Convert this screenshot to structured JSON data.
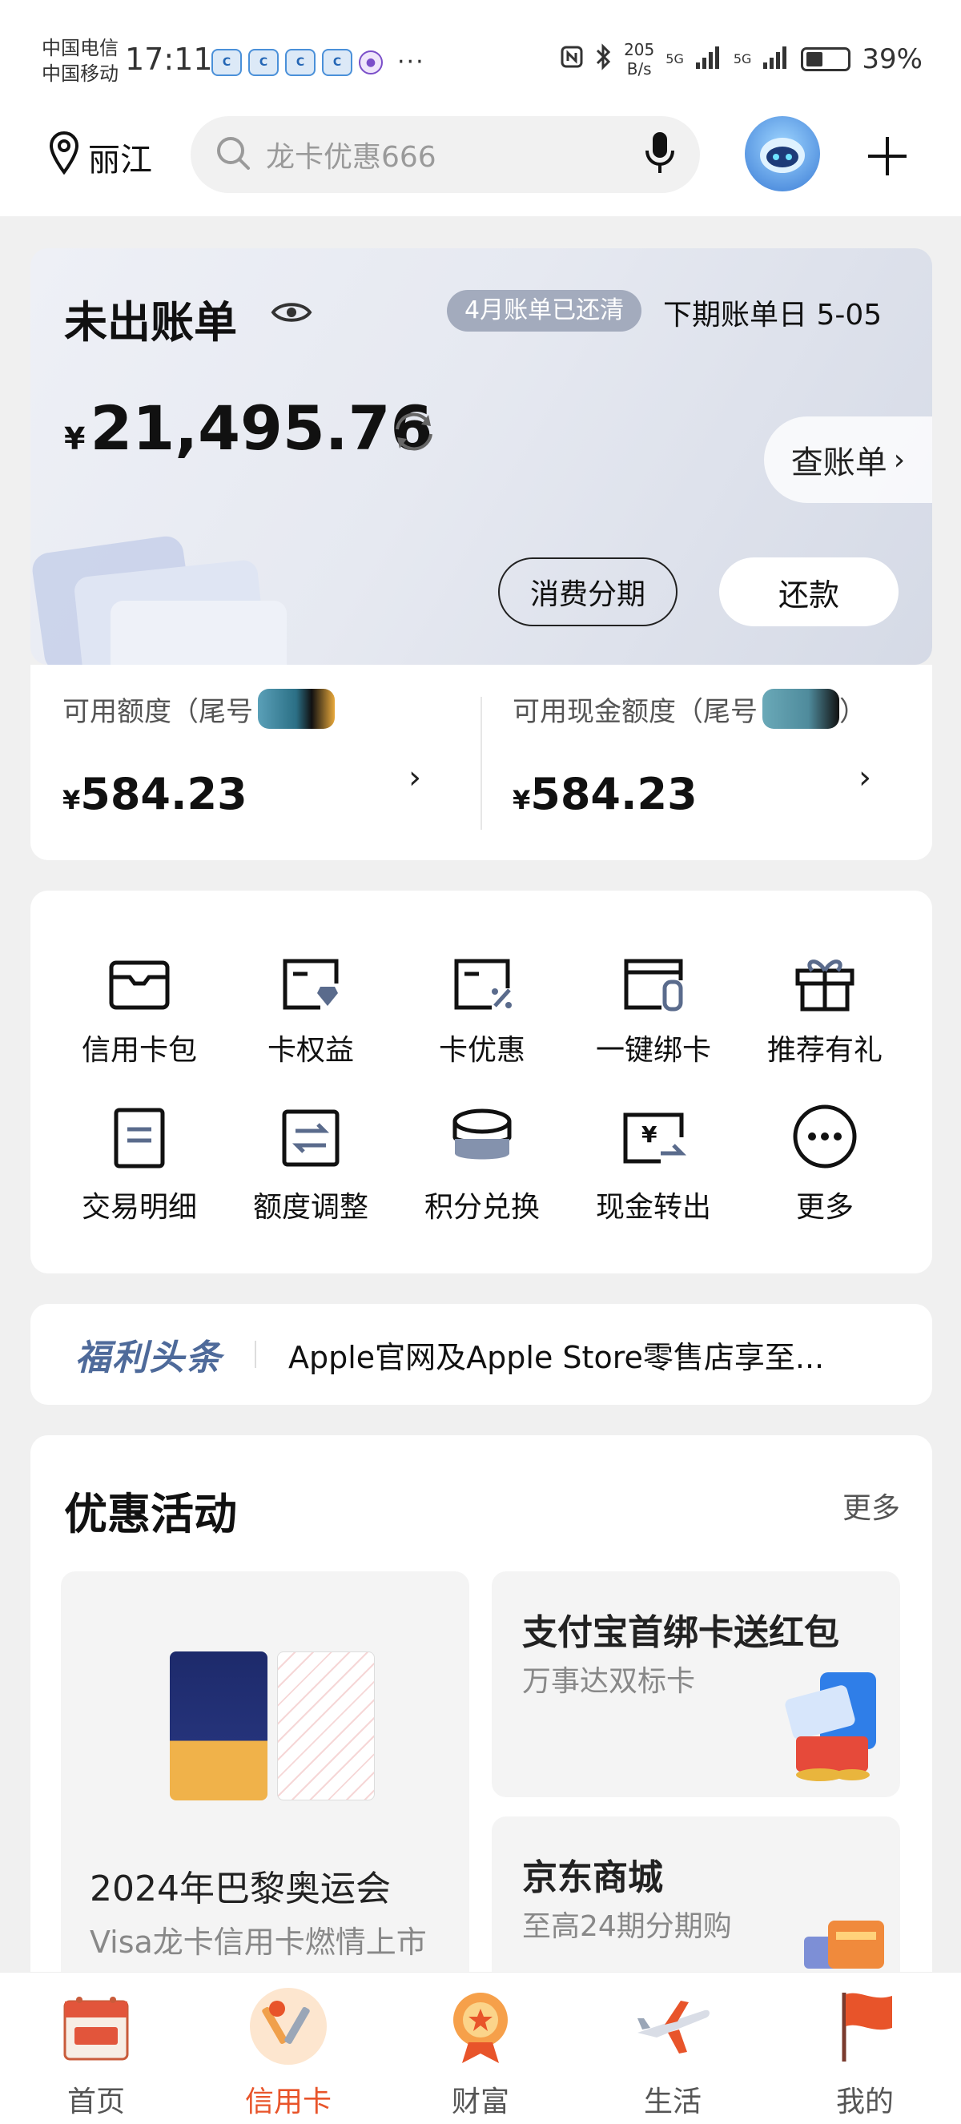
{
  "status_bar": {
    "carrier1": "中国电信",
    "carrier2": "中国移动",
    "time": "17:11",
    "net_speed_value": "205",
    "net_speed_unit": "B/s",
    "signal1": "5G",
    "signal2": "5G",
    "battery": "39%"
  },
  "header": {
    "city": "丽江",
    "search_placeholder": "龙卡优惠666"
  },
  "bill": {
    "title": "未出账单",
    "badge": "4月账单已还清",
    "next_due": "下期账单日 5-05",
    "currency": "¥",
    "amount": "21,495.76",
    "check_label": "查账单",
    "installment_label": "消费分期",
    "repay_label": "还款"
  },
  "limits": [
    {
      "label": "可用额度（尾号",
      "currency": "¥",
      "value": "584.23"
    },
    {
      "label": "可用现金额度（尾号",
      "suffix": "）",
      "currency": "¥",
      "value": "584.23"
    }
  ],
  "grid": [
    {
      "icon": "card-wallet-icon",
      "label": "信用卡包"
    },
    {
      "icon": "card-benefit-icon",
      "label": "卡权益"
    },
    {
      "icon": "card-discount-icon",
      "label": "卡优惠"
    },
    {
      "icon": "card-bind-icon",
      "label": "一键绑卡"
    },
    {
      "icon": "gift-icon",
      "label": "推荐有礼"
    },
    {
      "icon": "transaction-detail-icon",
      "label": "交易明细"
    },
    {
      "icon": "limit-adjust-icon",
      "label": "额度调整"
    },
    {
      "icon": "points-exchange-icon",
      "label": "积分兑换"
    },
    {
      "icon": "cash-transfer-icon",
      "label": "现金转出"
    },
    {
      "icon": "more-icon",
      "label": "更多"
    }
  ],
  "news": {
    "tag": "福利头条",
    "text": "Apple官网及Apple Store零售店享至..."
  },
  "promo": {
    "title": "优惠活动",
    "more": "更多",
    "cards": [
      {
        "title": "2024年巴黎奥运会",
        "subtitle": "Visa龙卡信用卡燃情上市"
      },
      {
        "title": "支付宝首绑卡送红包",
        "subtitle": "万事达双标卡"
      },
      {
        "title": "京东商城",
        "subtitle": "至高24期分期购"
      }
    ]
  },
  "tabs": [
    {
      "label": "首页",
      "icon": "labor-day-calendar-icon"
    },
    {
      "label": "信用卡",
      "icon": "credit-card-tools-icon",
      "active": true
    },
    {
      "label": "财富",
      "icon": "wealth-medal-icon"
    },
    {
      "label": "生活",
      "icon": "airplane-icon"
    },
    {
      "label": "我的",
      "icon": "flag-icon"
    }
  ],
  "colors": {
    "accent": "#e8542a",
    "badge_bg": "#a3abbd",
    "news_tag": "#4e6a9a"
  }
}
